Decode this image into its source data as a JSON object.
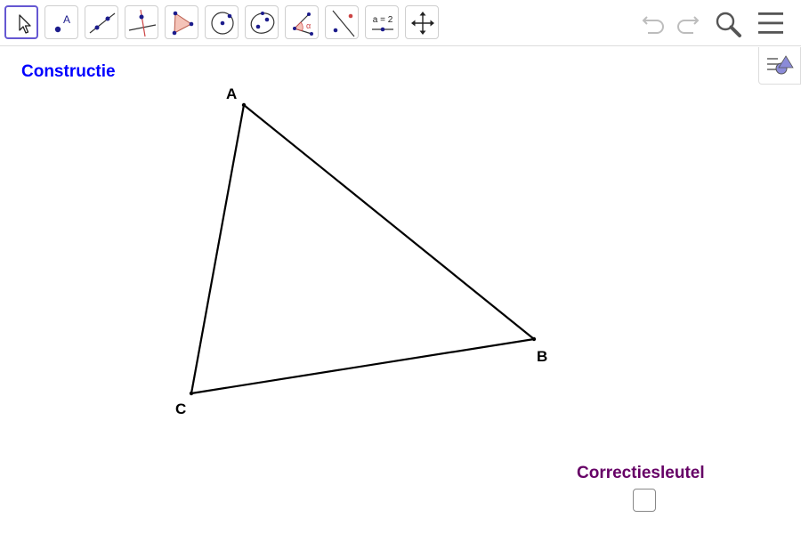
{
  "toolbar": {
    "tools": [
      {
        "name": "move-tool",
        "selected": true
      },
      {
        "name": "point-tool",
        "icon_text": "A"
      },
      {
        "name": "line-tool"
      },
      {
        "name": "perpendicular-line-tool"
      },
      {
        "name": "polygon-tool"
      },
      {
        "name": "circle-tool"
      },
      {
        "name": "conic-tool"
      },
      {
        "name": "angle-tool",
        "icon_text": "α"
      },
      {
        "name": "reflect-tool"
      },
      {
        "name": "slider-tool",
        "icon_text": "a = 2"
      },
      {
        "name": "move-graphics-view-tool"
      }
    ],
    "right_icons": [
      "undo-icon",
      "redo-icon",
      "search-icon",
      "menu-icon"
    ]
  },
  "side_panel_button": {
    "icon": "algebra-view-toggle-icon"
  },
  "construction": {
    "title": "Constructie",
    "title_color": "#0000ff",
    "points": {
      "A": {
        "label": "A"
      },
      "B": {
        "label": "B"
      },
      "C": {
        "label": "C"
      }
    },
    "segments": [
      [
        "A",
        "B"
      ],
      [
        "B",
        "C"
      ],
      [
        "C",
        "A"
      ]
    ]
  },
  "answer_key": {
    "label": "Correctiesleutel",
    "label_color": "#660066",
    "checked": false
  },
  "colors": {
    "accent": "#6557d2",
    "point_blue": "#1c1c8c",
    "polygon_fill": "#f4c3b8",
    "icon_gray": "#bdbdbd"
  }
}
